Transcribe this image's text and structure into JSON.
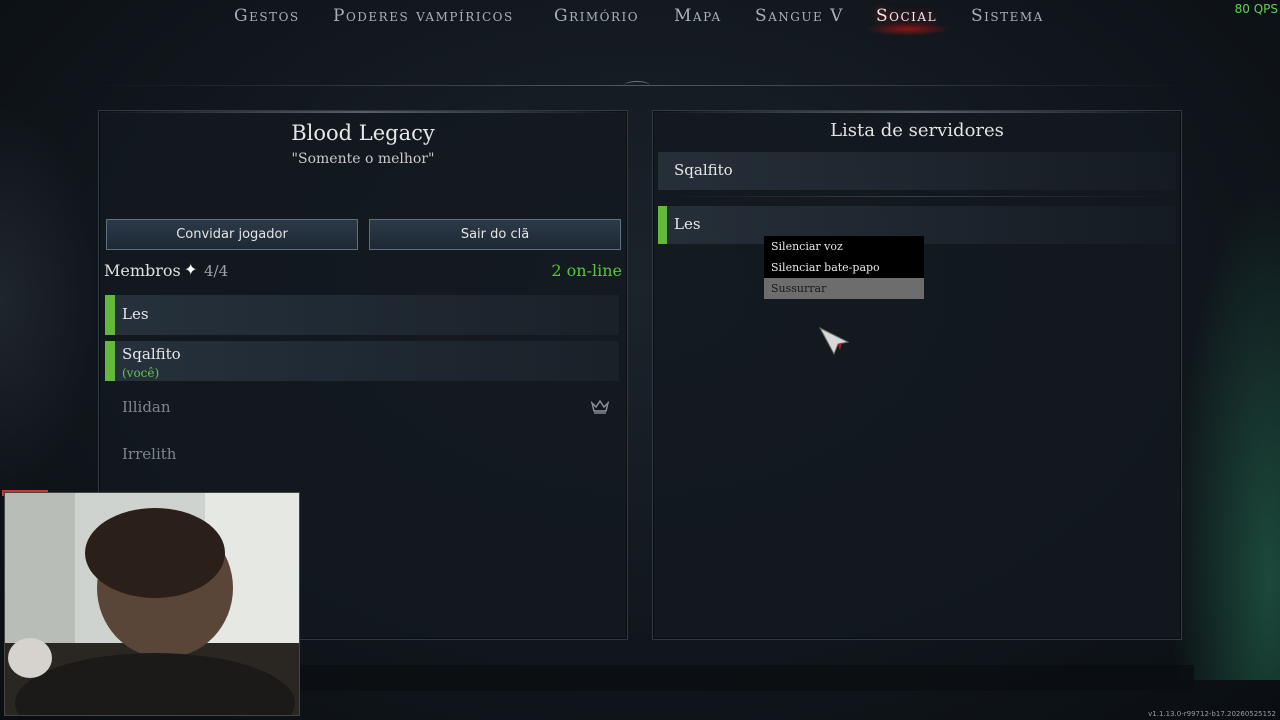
{
  "fps": "80 QPS",
  "nav": {
    "items": [
      "Gestos",
      "Poderes vampíricos",
      "Grimório",
      "Mapa",
      "Sangue V",
      "Social",
      "Sistema"
    ],
    "active": "Social"
  },
  "clan": {
    "name": "Blood Legacy",
    "motto": "\"Somente o melhor\"",
    "invite_label": "Convidar jogador",
    "leave_label": "Sair do clã",
    "members_label": "Membros",
    "members_star": "✦",
    "members_count": "4/4",
    "online_label": "2 on-line",
    "members": [
      {
        "name": "Les",
        "online": true
      },
      {
        "name": "Sqalfito",
        "online": true,
        "sub": "(você)"
      },
      {
        "name": "Illidan",
        "online": false,
        "leader": true
      },
      {
        "name": "Irrelith",
        "online": false
      }
    ]
  },
  "servers": {
    "title": "Lista de servidores",
    "rows": [
      {
        "name": "Sqalfito"
      },
      {
        "name": "Les"
      }
    ]
  },
  "context_menu": {
    "items": [
      "Silenciar voz",
      "Silenciar bate-papo",
      "Sussurrar"
    ],
    "hovered": "Sussurrar"
  },
  "version": "v1.1.13.0-r99712-b17.20260525152",
  "colors": {
    "online_green": "#63b93a",
    "active_red": "#c01818"
  },
  "icons": {
    "leader": "crown-icon",
    "cursor": "arrow-cursor-icon"
  }
}
